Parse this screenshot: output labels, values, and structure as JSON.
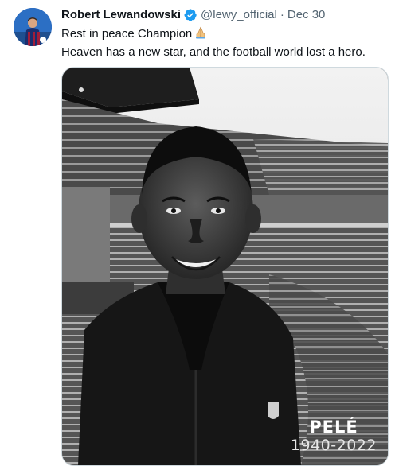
{
  "tweet": {
    "author_name": "Robert Lewandowski",
    "handle": "@lewy_official",
    "separator": "·",
    "date": "Dec 30",
    "line1": "Rest in peace Champion",
    "line2": "Heaven has a new star, and the football world lost a hero.",
    "emoji_icon": "folded-hands-icon",
    "verified_icon": "verified-badge-icon",
    "accent_color": "#1d9bf0"
  },
  "media": {
    "caption_name": "PELÉ",
    "caption_years": "1940-2022"
  }
}
